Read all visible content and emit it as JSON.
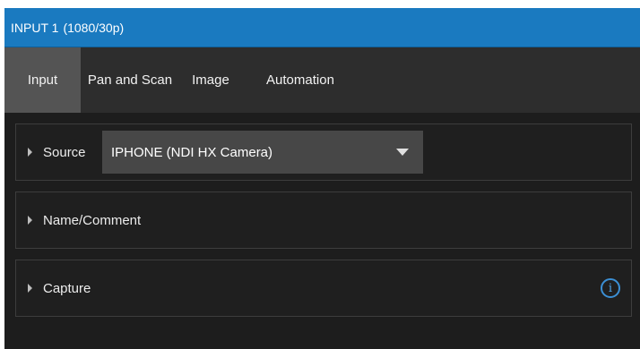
{
  "header": {
    "title": "INPUT 1",
    "format": "(1080/30p)"
  },
  "tabs": [
    {
      "label": "Input",
      "active": true
    },
    {
      "label": "Pan and Scan",
      "active": false
    },
    {
      "label": "Image",
      "active": false
    },
    {
      "label": "Automation",
      "active": false
    }
  ],
  "panels": {
    "source": {
      "label": "Source",
      "selected": "IPHONE (NDI HX Camera)"
    },
    "name_comment": {
      "label": "Name/Comment"
    },
    "capture": {
      "label": "Capture",
      "info_glyph": "i"
    }
  },
  "colors": {
    "title_bar": "#1a7ac0",
    "active_tab": "#545454",
    "info_icon": "#3b8fd4"
  },
  "icons": {
    "disclosure": "disclosure-triangle-icon",
    "dropdown": "chevron-down-icon",
    "info": "info-icon"
  }
}
